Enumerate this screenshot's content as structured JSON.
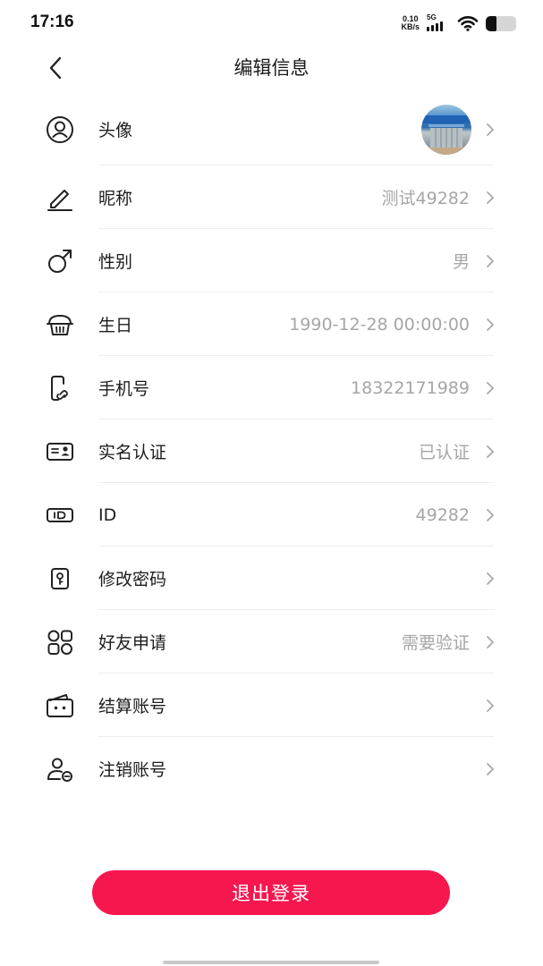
{
  "status_bar": {
    "time": "17:16",
    "net_speed_value": "0.10",
    "net_speed_unit": "KB/s",
    "network_type": "5G",
    "signal_icon": "signal-bars-icon",
    "wifi_icon": "wifi-icon",
    "battery_icon": "battery-icon",
    "battery_level": 0.35
  },
  "header": {
    "back_icon": "chevron-left-icon",
    "title": "编辑信息"
  },
  "rows": [
    {
      "key": "avatar",
      "icon": "user-circle-icon",
      "label": "头像",
      "value": ""
    },
    {
      "key": "nickname",
      "icon": "pen-icon",
      "label": "昵称",
      "value": "测试49282"
    },
    {
      "key": "gender",
      "icon": "male-symbol-icon",
      "label": "性别",
      "value": "男"
    },
    {
      "key": "birthday",
      "icon": "cupcake-icon",
      "label": "生日",
      "value": "1990-12-28 00:00:00"
    },
    {
      "key": "phone",
      "icon": "phone-link-icon",
      "label": "手机号",
      "value": "18322171989"
    },
    {
      "key": "real-name",
      "icon": "id-card-icon",
      "label": "实名认证",
      "value": "已认证"
    },
    {
      "key": "id",
      "icon": "id-badge-icon",
      "label": "ID",
      "value": "49282"
    },
    {
      "key": "change-password",
      "icon": "key-lock-icon",
      "label": "修改密码",
      "value": ""
    },
    {
      "key": "friend-requests",
      "icon": "apps-grid-icon",
      "label": "好友申请",
      "value": "需要验证"
    },
    {
      "key": "settlement-account",
      "icon": "wallet-icon",
      "label": "结算账号",
      "value": ""
    },
    {
      "key": "cancel-account",
      "icon": "user-remove-icon",
      "label": "注销账号",
      "value": ""
    }
  ],
  "logout": {
    "label": "退出登录"
  },
  "colors": {
    "accent": "#f7174f",
    "value_text": "#a6a6a6",
    "label_text": "#1c1c1c",
    "divider": "#eeeeee"
  }
}
